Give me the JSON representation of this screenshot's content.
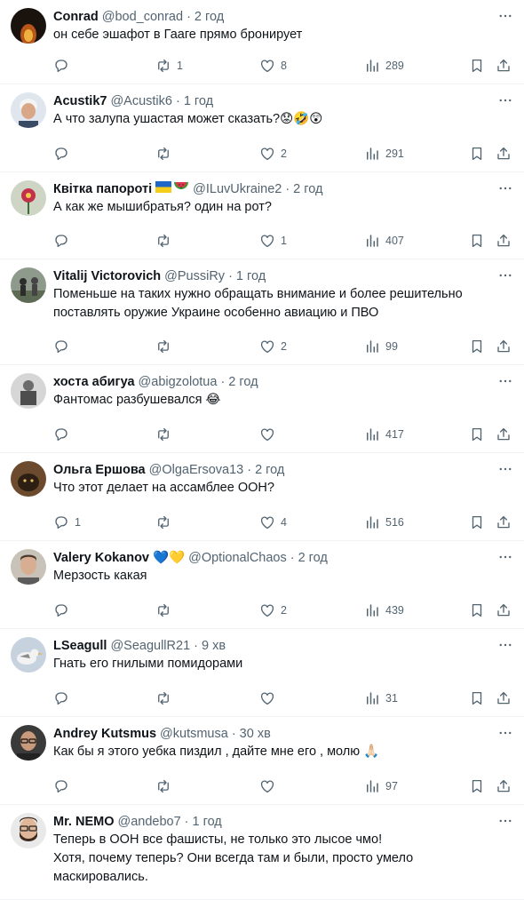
{
  "colors": {
    "text": "#0f1419",
    "muted": "#536471",
    "divider": "#eff3f4"
  },
  "tweets": [
    {
      "name": "Conrad",
      "handle": "@bod_conrad",
      "time": "2 год",
      "text": [
        "он себе эшафот в Гааге прямо бронирует"
      ],
      "replies": "",
      "retweets": "1",
      "likes": "8",
      "views": "289",
      "avatar": "dark-fire"
    },
    {
      "name": "Acustik7",
      "handle": "@Acustik6",
      "time": "1 год",
      "text": [
        "А что залупа ушастая может сказать?😟🤣😲"
      ],
      "replies": "",
      "retweets": "",
      "likes": "2",
      "views": "291",
      "avatar": "man-white-hair"
    },
    {
      "name": "Квітка папороті",
      "handle": "@ILuvUkraine2",
      "time": "2 год",
      "text": [
        "А как же мышибратья? один на рот?"
      ],
      "replies": "",
      "retweets": "",
      "likes": "1",
      "views": "407",
      "avatar": "flower"
    },
    {
      "name": "Vitalij Victorovich",
      "handle": "@PussiRy",
      "time": "1 год",
      "text": [
        "Поменьше на таких нужно обращать внимание и более решительно",
        "поставлять оружие Украине особенно авиацию и ПВО"
      ],
      "replies": "",
      "retweets": "",
      "likes": "2",
      "views": "99",
      "avatar": "people-outdoor"
    },
    {
      "name": "хоста абигуа",
      "handle": "@abigzolotua",
      "time": "2 год",
      "text": [
        "Фантомас разбушевался 😂"
      ],
      "replies": "",
      "retweets": "",
      "likes": "",
      "views": "417",
      "avatar": "soldier"
    },
    {
      "name": "Ольга Ершова",
      "handle": "@OlgaErsova13",
      "time": "2 год",
      "text": [
        "Что этот делает на ассамблее ООН?"
      ],
      "replies": "1",
      "retweets": "",
      "likes": "4",
      "views": "516",
      "avatar": "cat"
    },
    {
      "name": "Valery Kokanov",
      "handle": "@OptionalChaos",
      "time": "2 год",
      "name_emoji": "💙💛",
      "text": [
        "Мерзость какая"
      ],
      "replies": "",
      "retweets": "",
      "likes": "2",
      "views": "439",
      "avatar": "man-face"
    },
    {
      "name": "LSeagull",
      "handle": "@SeagullR21",
      "time": "9 хв",
      "text": [
        "Гнать его гнилыми помидорами"
      ],
      "replies": "",
      "retweets": "",
      "likes": "",
      "views": "31",
      "avatar": "seagull"
    },
    {
      "name": "Andrey Kutsmus",
      "handle": "@kutsmusa",
      "time": "30 хв",
      "text": [
        "Как бы я этого уебка пиздил , дайте мне его , молю 🙏🏻"
      ],
      "replies": "",
      "retweets": "",
      "likes": "",
      "views": "97",
      "avatar": "man-glasses"
    },
    {
      "name": "Mr. NEMO",
      "handle": "@andebo7",
      "time": "1 год",
      "text": [
        "Теперь в ООН все фашисты, не только это лысое чмо!",
        "Хотя, почему теперь? Они всегда там и были, просто умело",
        "маскировались."
      ],
      "replies": "",
      "retweets": "",
      "likes": "",
      "views": "",
      "avatar": "bearded-man"
    }
  ]
}
